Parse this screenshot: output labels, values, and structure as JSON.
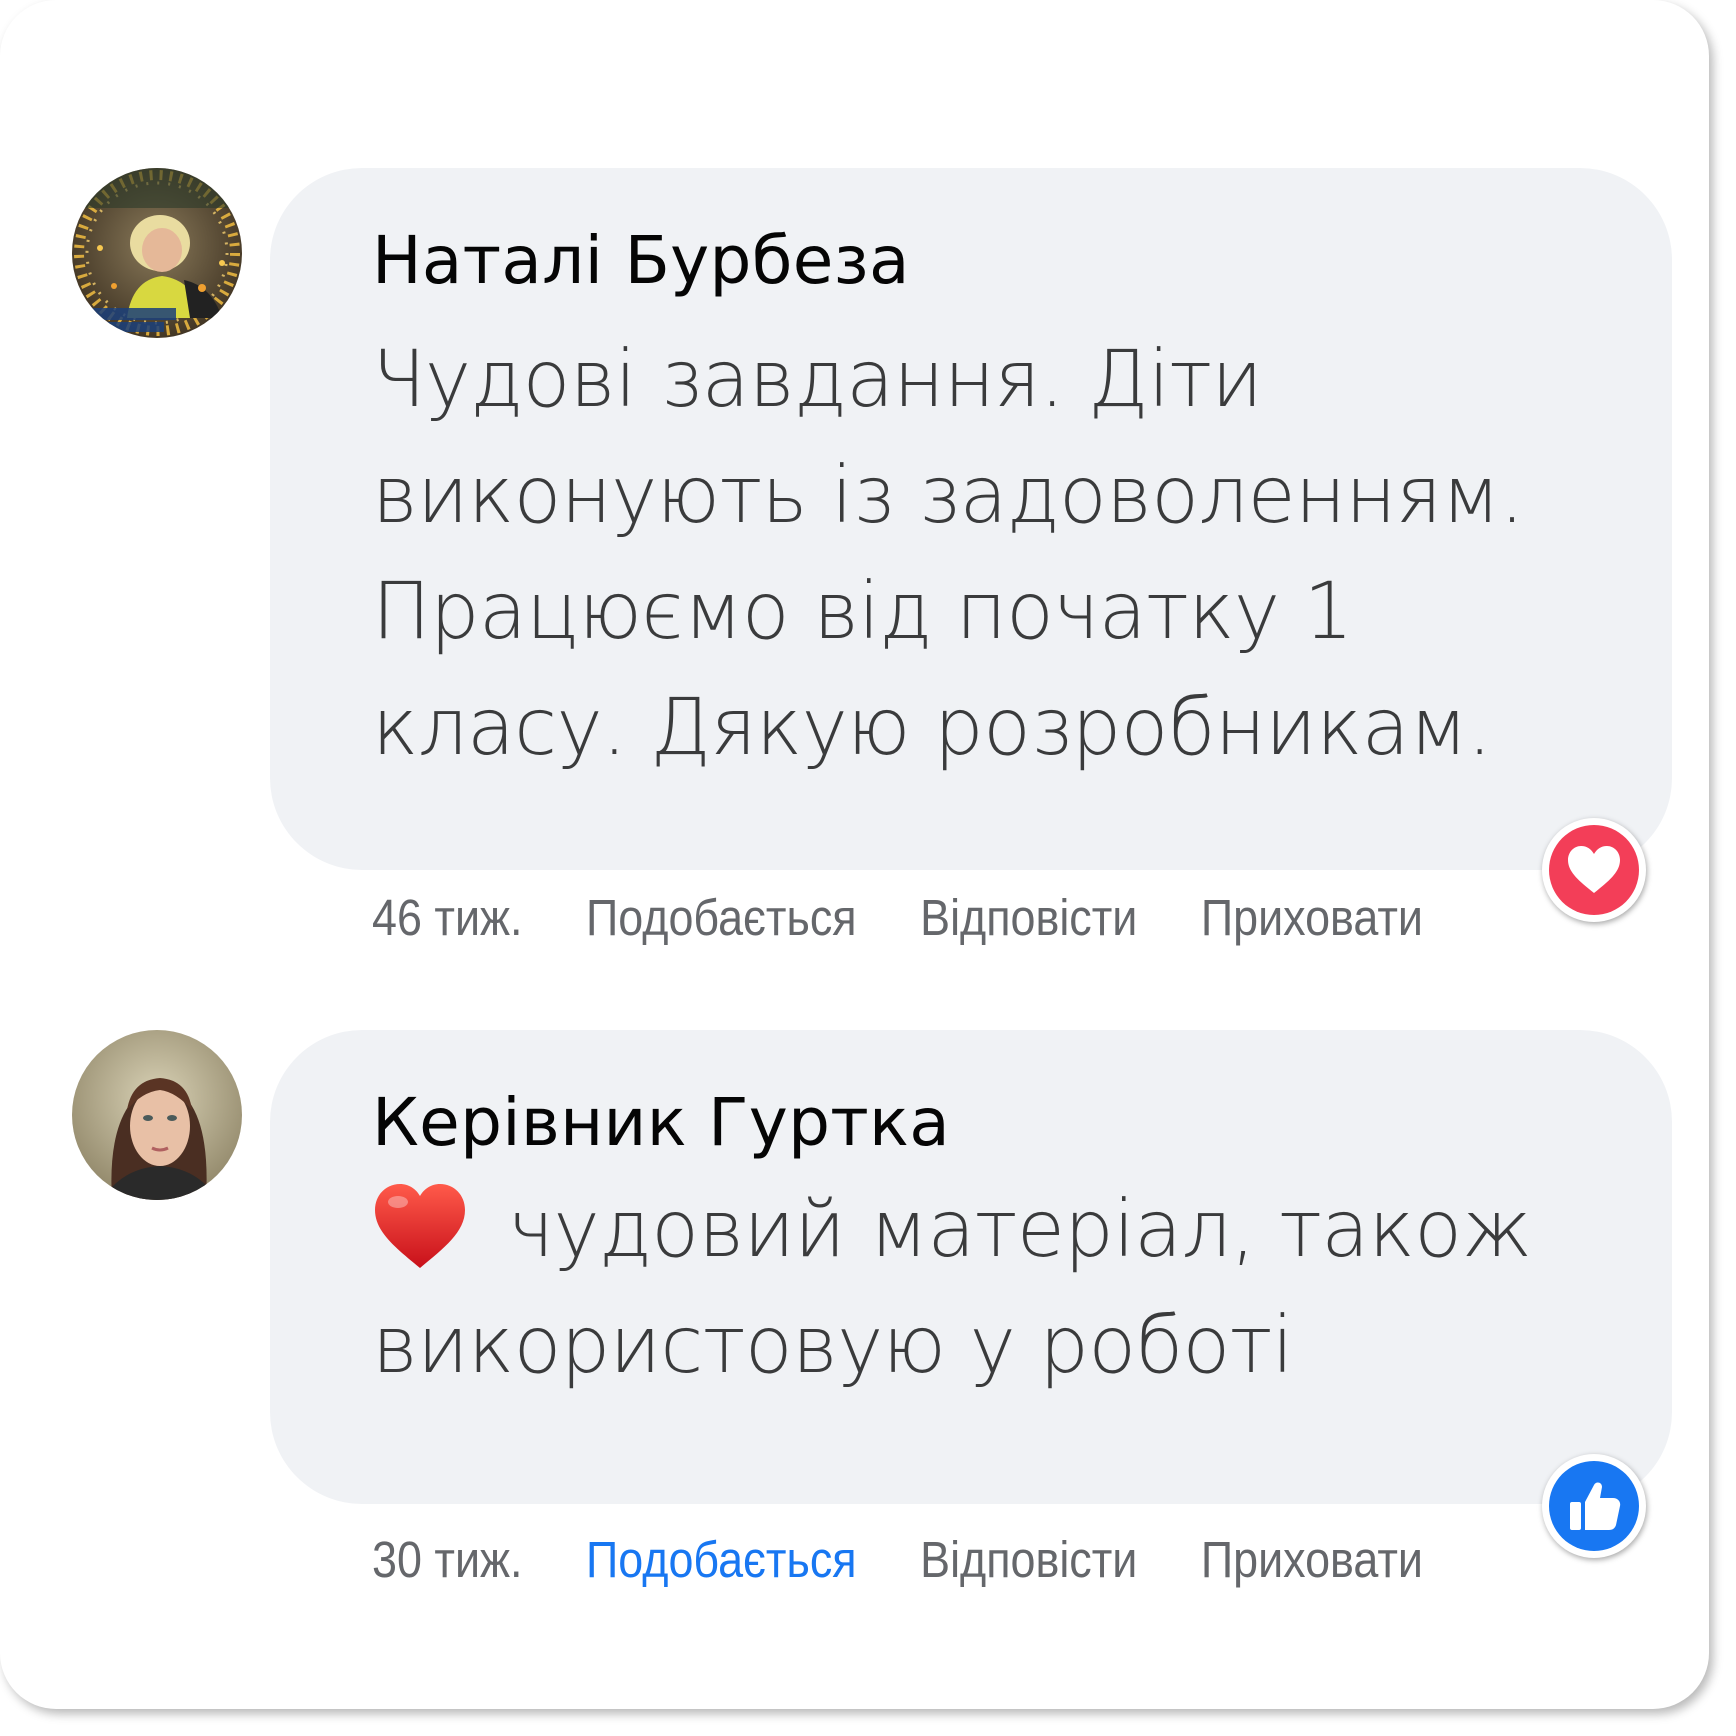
{
  "comments": [
    {
      "author": "Наталі Бурбеза",
      "body_lines": [
        "Чудові завдання. Діти",
        "виконують із задоволенням.",
        "Працюємо від початку 1",
        "класу. Дякую розробникам."
      ],
      "time": "46 тиж.",
      "like_label": "Подобається",
      "reply_label": "Відповісти",
      "hide_label": "Приховати",
      "liked": false,
      "reaction": "love-icon",
      "avatar": "avatar-photo"
    },
    {
      "author": "Керівник Гуртка",
      "emoji": "red-heart-emoji",
      "body_lines": [
        "чудовий матеріал, також",
        "використовую у роботі"
      ],
      "time": "30 тиж.",
      "like_label": "Подобається",
      "reply_label": "Відповісти",
      "hide_label": "Приховати",
      "liked": true,
      "reaction": "like-icon",
      "avatar": "avatar-photo"
    }
  ],
  "colors": {
    "bubble": "#f0f2f5",
    "author": "#050505",
    "body": "#3a3b3c",
    "meta": "#65676b",
    "link_active": "#1877f2",
    "love": "#f33e58",
    "like": "#1877f2"
  }
}
